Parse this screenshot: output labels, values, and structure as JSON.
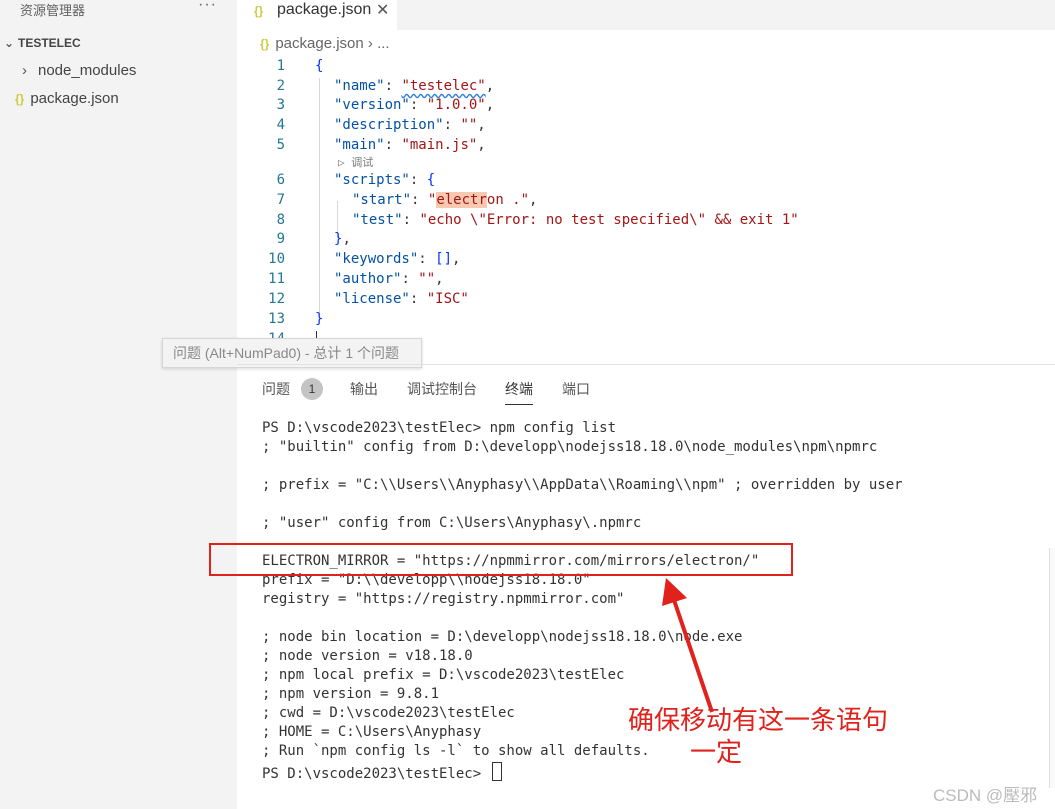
{
  "sidebar": {
    "title": "资源管理器",
    "more": "···",
    "root": "TESTELEC",
    "items": [
      {
        "label": "node_modules",
        "icon": "chevron-right-icon"
      },
      {
        "label": "package.json",
        "icon": "json-braces-icon"
      }
    ]
  },
  "tab": {
    "label": "package.json",
    "icon": "{}",
    "close": "✕"
  },
  "breadcrumb": {
    "file": "package.json",
    "sep": "›",
    "rest": "..."
  },
  "editor": {
    "line_numbers": [
      "1",
      "2",
      "3",
      "4",
      "5",
      "6",
      "7",
      "8",
      "9",
      "10",
      "11",
      "12",
      "13",
      "14"
    ],
    "codelens": "调试",
    "lines": {
      "l1": "{",
      "l2_key": "\"name\"",
      "l2_val": "\"testelec\"",
      "l3_key": "\"version\"",
      "l3_val": "\"1.0.0\"",
      "l4_key": "\"description\"",
      "l4_val": "\"\"",
      "l5_key": "\"main\"",
      "l5_val": "\"main.js\"",
      "l6_key": "\"scripts\"",
      "l7_key": "\"start\"",
      "l7_val_pre": "\"",
      "l7_val_hl": "electr",
      "l7_val_post": "on .\"",
      "l8_key": "\"test\"",
      "l8_val": "\"echo \\\"Error: no test specified\\\" && exit 1\"",
      "l10_key": "\"keywords\"",
      "l11_key": "\"author\"",
      "l11_val": "\"\"",
      "l12_key": "\"license\"",
      "l12_val": "\"ISC\"",
      "l13": "}"
    }
  },
  "tooltip": "问题 (Alt+NumPad0) - 总计 1 个问题",
  "panel": {
    "tabs": [
      "问题",
      "输出",
      "调试控制台",
      "终端",
      "端口"
    ],
    "active_tab": "终端",
    "problem_count": "1"
  },
  "terminal": {
    "lines": [
      "PS D:\\vscode2023\\testElec> npm config list",
      "; \"builtin\" config from D:\\developp\\nodejss18.18.0\\node_modules\\npm\\npmrc",
      "",
      "; prefix = \"C:\\\\Users\\\\Anyphasy\\\\AppData\\\\Roaming\\\\npm\" ; overridden by user",
      "",
      "; \"user\" config from C:\\Users\\Anyphasy\\.npmrc",
      "",
      "ELECTRON_MIRROR = \"https://npmmirror.com/mirrors/electron/\"",
      "prefix = \"D:\\\\developp\\\\nodejss18.18.0\"",
      "registry = \"https://registry.npmmirror.com\"",
      "",
      "; node bin location = D:\\developp\\nodejss18.18.0\\node.exe",
      "; node version = v18.18.0",
      "; npm local prefix = D:\\vscode2023\\testElec",
      "; npm version = 9.8.1",
      "; cwd = D:\\vscode2023\\testElec",
      "; HOME = C:\\Users\\Anyphasy",
      "; Run `npm config ls -l` to show all defaults."
    ],
    "prompt": "PS D:\\vscode2023\\testElec> "
  },
  "annotation": {
    "line1": "确保移动有这一条语句",
    "line2": "一定",
    "color": "#e0211c"
  },
  "watermark": "CSDN @壓邪"
}
